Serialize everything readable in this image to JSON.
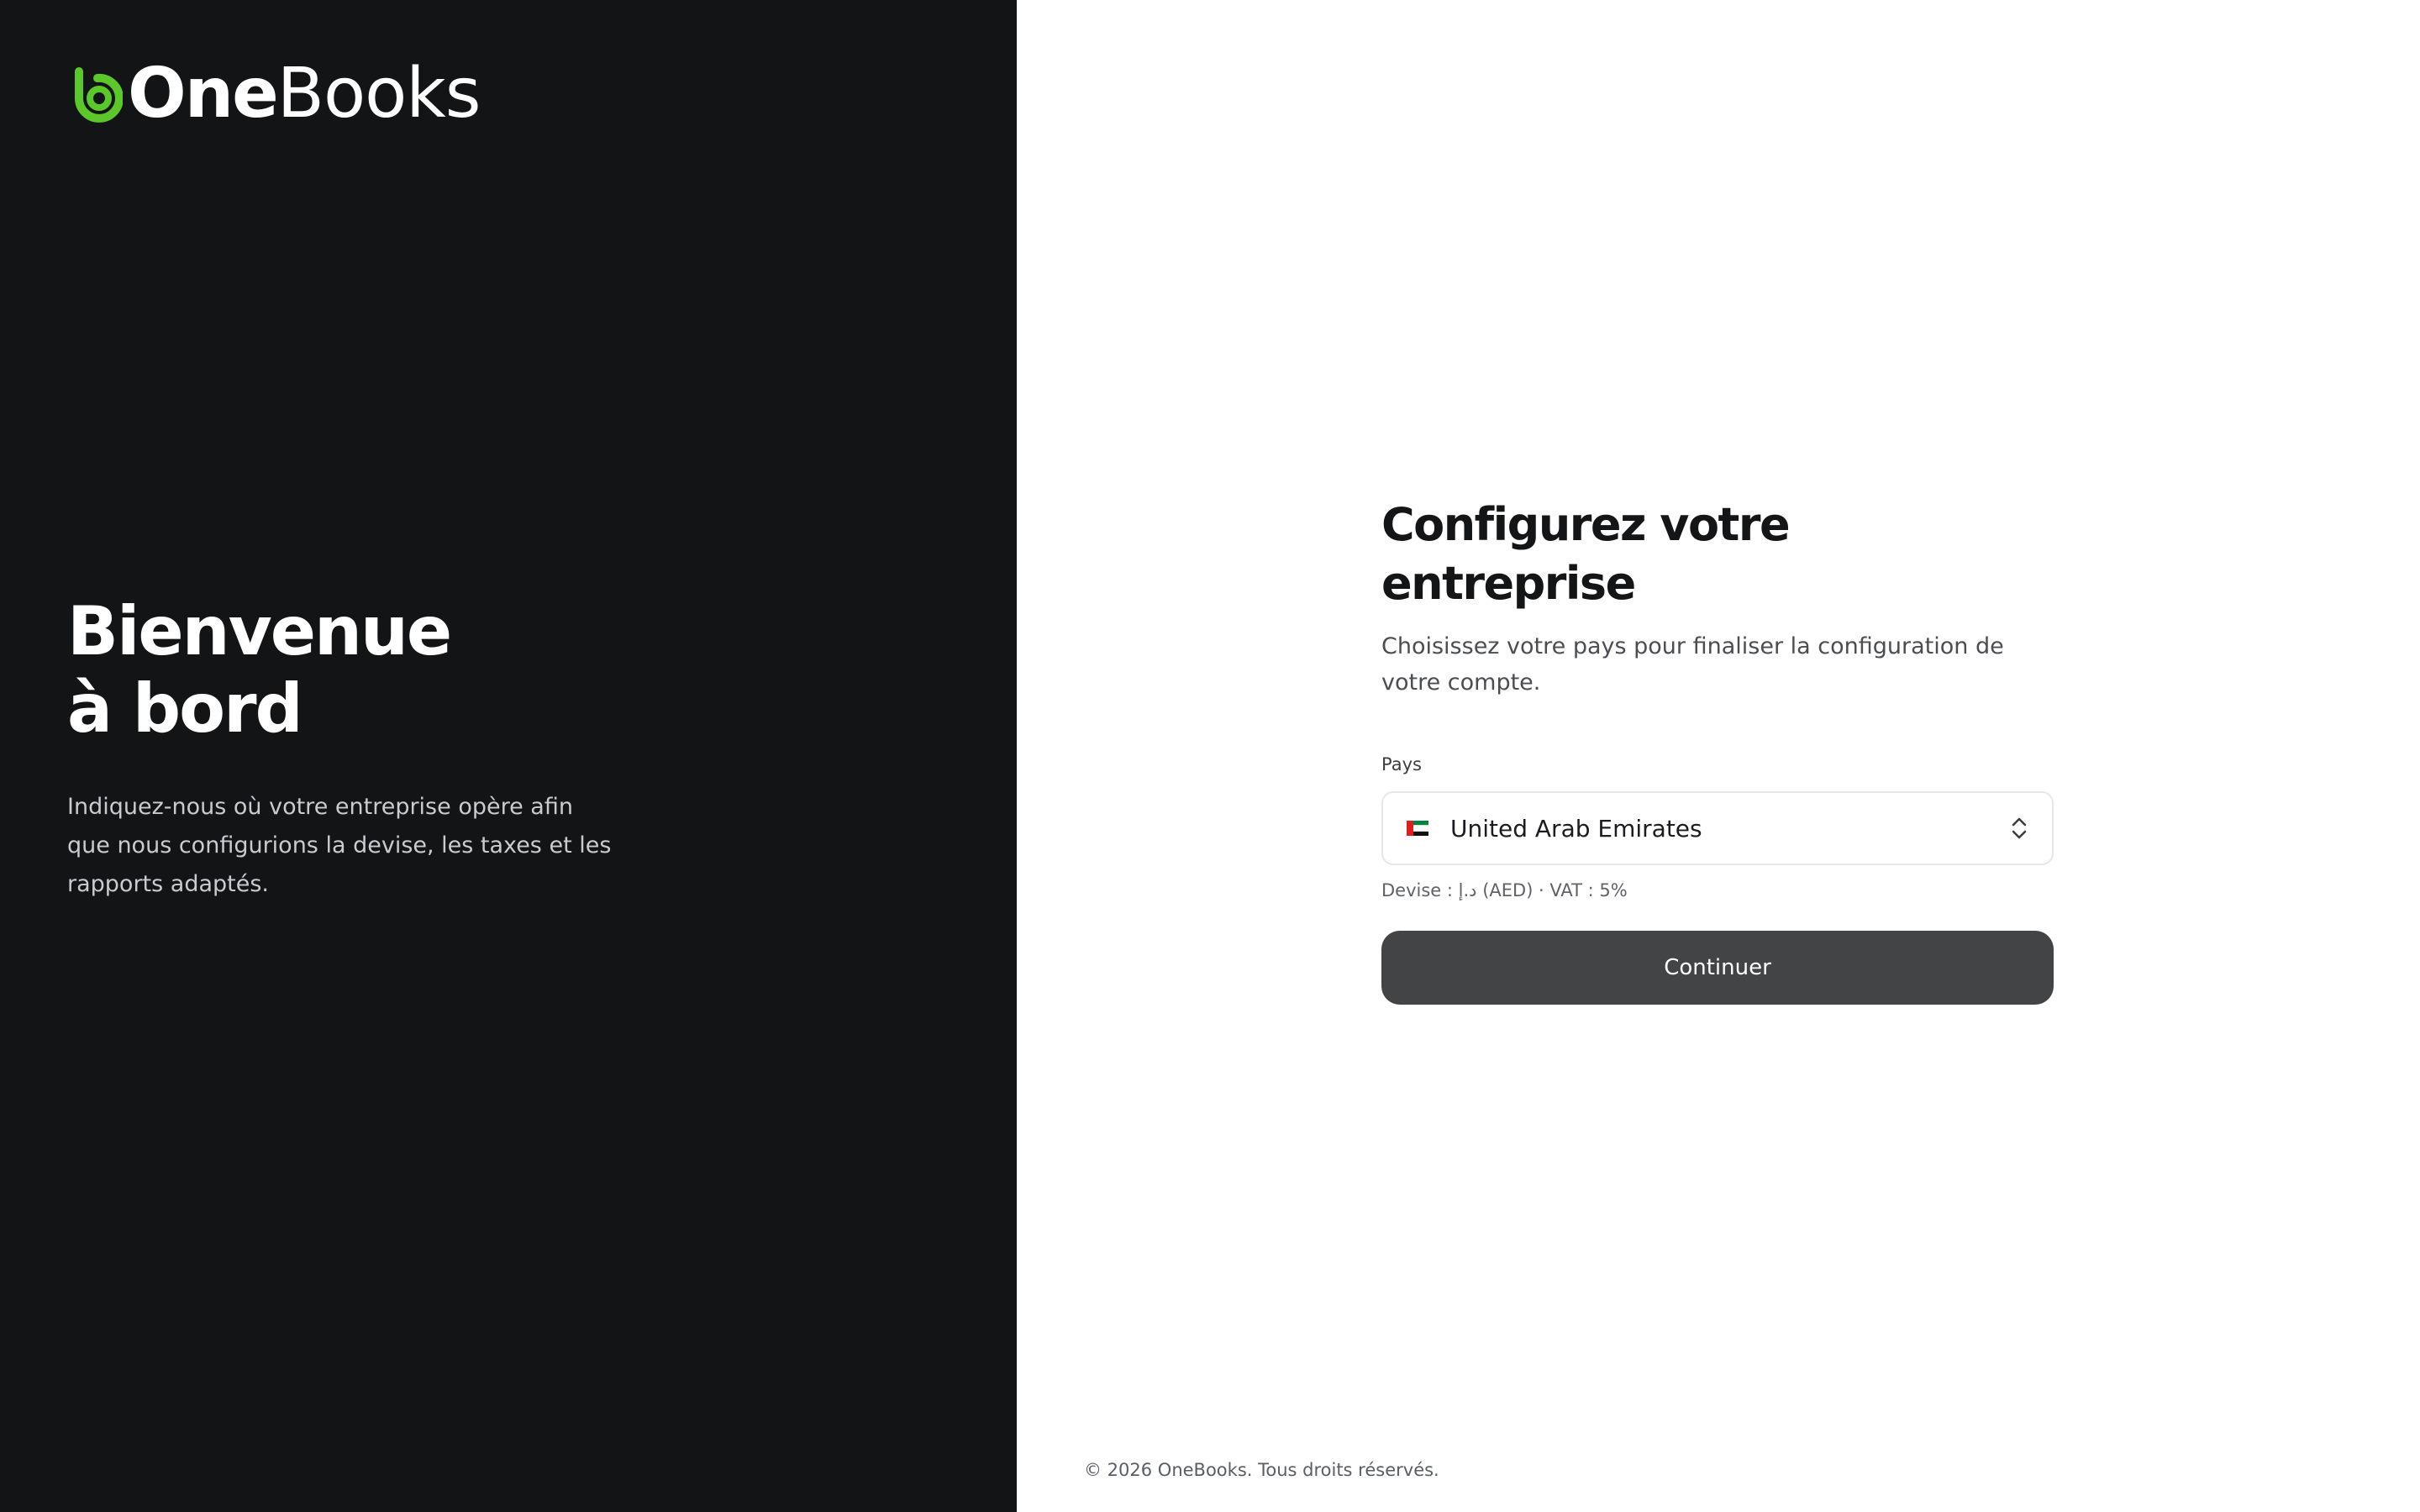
{
  "brand": {
    "name_part1": "One",
    "name_part2": "Books",
    "accent_color": "#5cc72a",
    "icon": "onebooks-logo-icon"
  },
  "welcome": {
    "line1": "Bienvenue",
    "line2": "à bord",
    "description": "Indiquez-nous où votre entreprise opère afin que nous configurions la devise, les taxes et les rapports adaptés."
  },
  "form": {
    "title": "Configurez votre entreprise",
    "subtitle": "Choisissez votre pays pour finaliser la configuration de votre compte.",
    "country_label": "Pays",
    "country_value": "United Arab Emirates",
    "flag_icon": "uae-flag-icon",
    "hint": "Devise : د.إ (AED) · VAT : 5%",
    "submit_label": "Continuer"
  },
  "footer": {
    "copyright": "© 2026 OneBooks. Tous droits réservés."
  },
  "colors": {
    "left_panel_bg": "#131416",
    "button_bg": "#434446"
  }
}
